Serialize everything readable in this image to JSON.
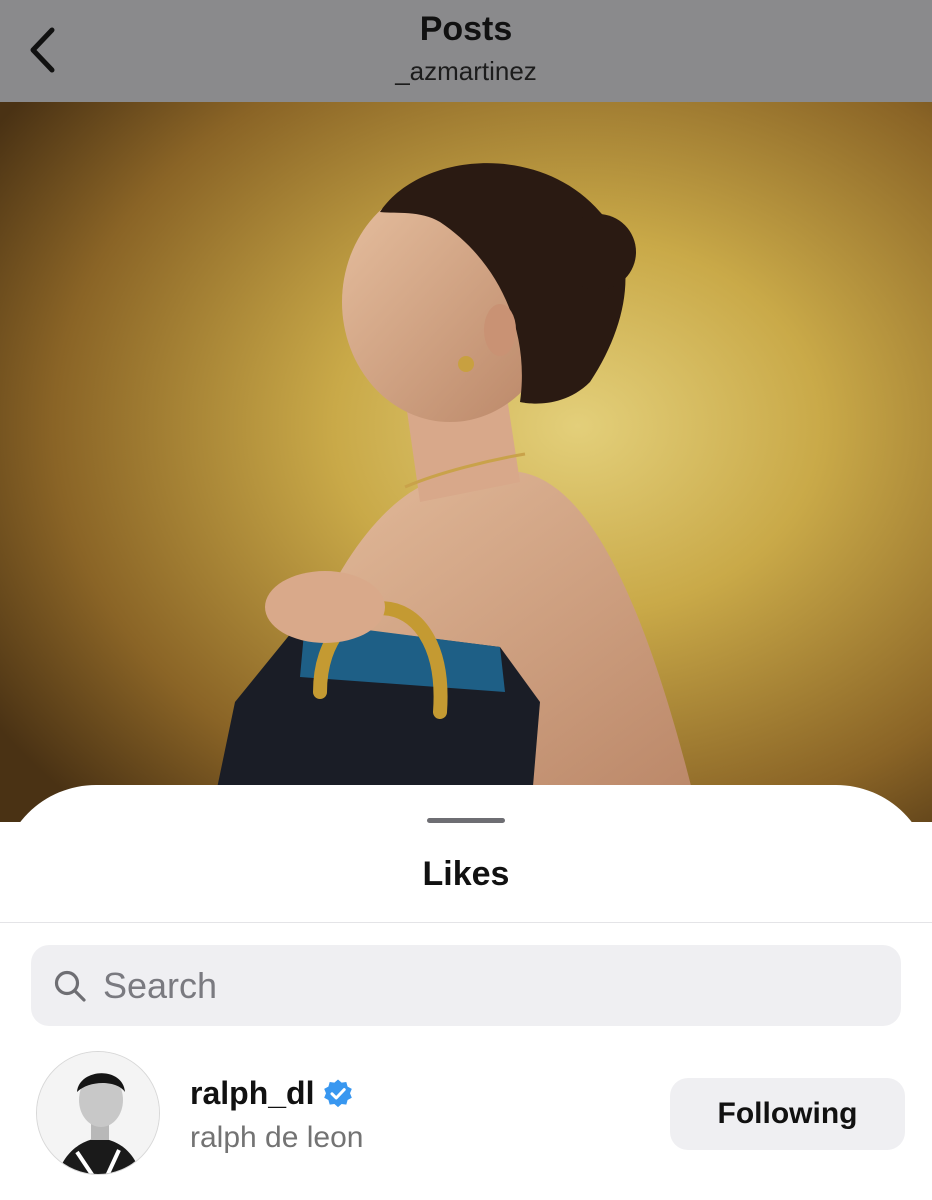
{
  "header": {
    "title": "Posts",
    "username": "_azmartinez",
    "back_icon": "chevron-left-icon"
  },
  "post": {
    "image_subject": "",
    "background_color": "#c9a948"
  },
  "sheet": {
    "title": "Likes"
  },
  "search": {
    "placeholder": "Search",
    "value": "",
    "icon": "search-icon"
  },
  "likes": [
    {
      "username": "ralph_dl",
      "full_name": "ralph de leon",
      "verified": true,
      "verified_color": "#3897f0",
      "button_label": "Following"
    }
  ],
  "colors": {
    "header_bg": "#8a8a8c",
    "button_bg": "#efeff2",
    "secondary_text": "#737373"
  }
}
